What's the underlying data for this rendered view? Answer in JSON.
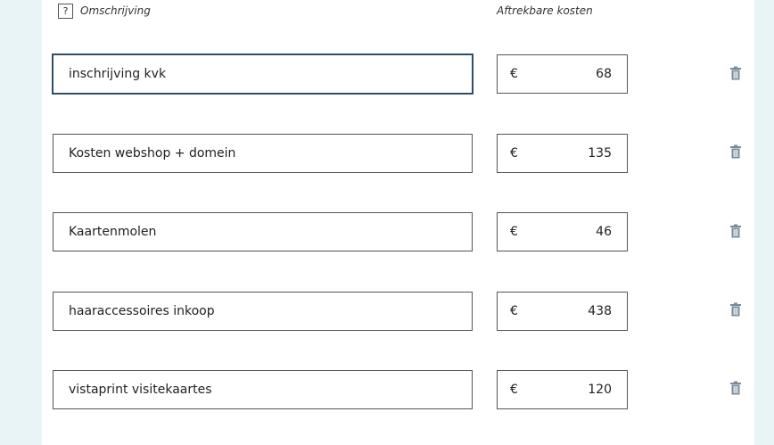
{
  "header": {
    "help_icon_label": "?",
    "description_label": "Omschrijving",
    "cost_label": "Aftrekbare kosten"
  },
  "rows": [
    {
      "description": "inschrijving kvk",
      "currency": "€",
      "amount": "68"
    },
    {
      "description": "Kosten webshop + domein",
      "currency": "€",
      "amount": "135"
    },
    {
      "description": "Kaartenmolen",
      "currency": "€",
      "amount": "46"
    },
    {
      "description": "haaraccessoires inkoop",
      "currency": "€",
      "amount": "438"
    },
    {
      "description": "vistaprint visitekaartes",
      "currency": "€",
      "amount": "120"
    }
  ],
  "colors": {
    "page_background": "#e9f4f7",
    "panel_background": "#ffffff",
    "trash_icon": "#7a8a99",
    "focus_border": "#2f4e66"
  },
  "icons": {
    "help": "help-icon",
    "delete": "trash-icon"
  }
}
